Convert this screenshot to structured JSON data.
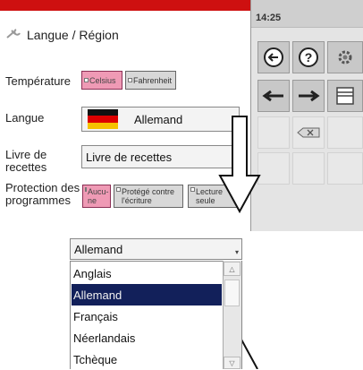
{
  "window": {
    "title": "Langue / Région",
    "clock": "14:25"
  },
  "settings": {
    "temperature": {
      "label": "Température",
      "options": [
        "Celsius",
        "Fahrenheit"
      ],
      "selected": "Celsius"
    },
    "language": {
      "label": "Langue",
      "value": "Allemand"
    },
    "recipe_book": {
      "label_line1": "Livre de",
      "label_line2": "recettes",
      "value": "Livre de recettes"
    },
    "program_protection": {
      "label_line1": "Protection des",
      "label_line2": "programmes",
      "options": [
        {
          "line1": "Aucu-",
          "line2": "ne"
        },
        {
          "line1": "Protégé contre",
          "line2": "l'écriture"
        },
        {
          "line1": "Lecture",
          "line2": "seule"
        }
      ],
      "selected": "Aucune"
    }
  },
  "toolbar": {
    "buttons": [
      "back-icon",
      "help-icon",
      "settings-gear-icon",
      "arrow-left-icon",
      "arrow-right-icon",
      "window-icon",
      "backspace-icon"
    ]
  },
  "dropdown": {
    "current_value": "Allemand",
    "items": [
      "Anglais",
      "Allemand",
      "Français",
      "Néerlandais",
      "Tchèque"
    ],
    "highlighted_index": 1
  },
  "colors": {
    "title_bar": "#ce1010",
    "selected_option": "#ef9ab5",
    "highlight": "#12205a",
    "panel_bg": "#e4e4e4"
  }
}
